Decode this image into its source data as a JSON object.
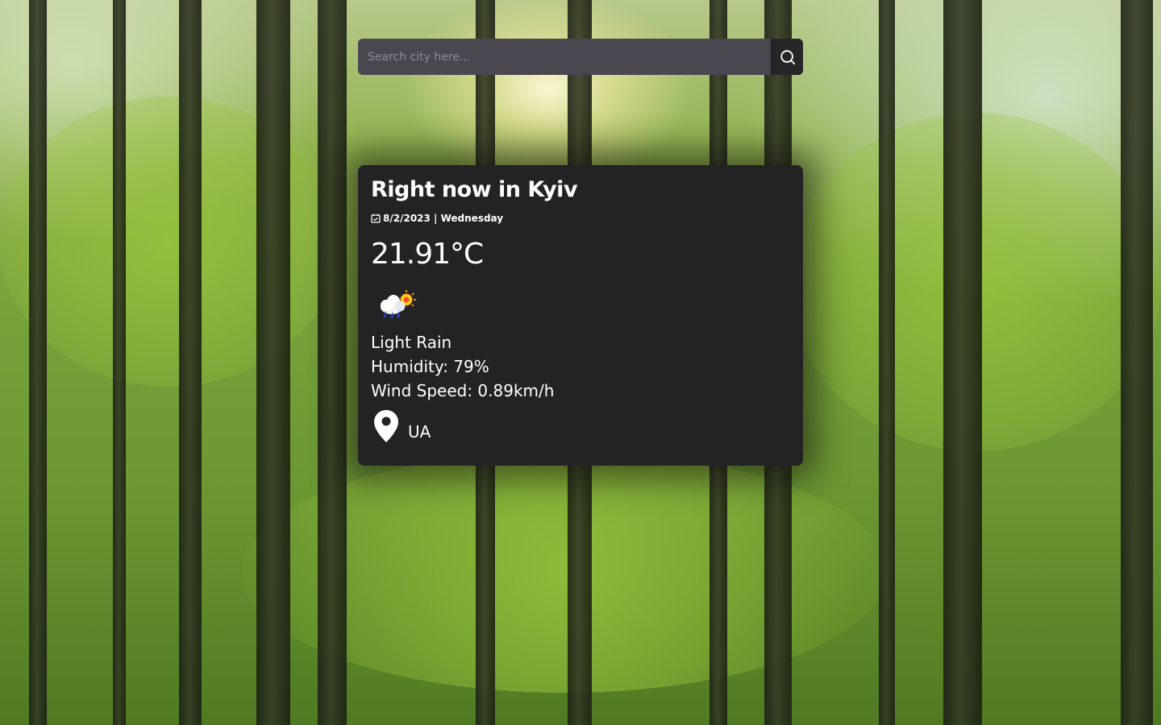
{
  "search": {
    "placeholder": "Search city here...",
    "value": ""
  },
  "weather": {
    "title": "Right now in Kyiv",
    "date": "8/2/2023 | Wednesday",
    "temperature": "21.91°C",
    "condition": "Light Rain",
    "humidity": "Humidity: 79%",
    "wind": "Wind Speed: 0.89km/h",
    "country": "UA"
  },
  "icons": {
    "search": "search-icon",
    "calendar": "calendar-icon",
    "weather": "light-rain-icon",
    "location": "map-pin-icon"
  },
  "colors": {
    "card_bg": "#232224",
    "search_bg": "#4a4750",
    "search_button_bg": "#262527",
    "text": "#ffffff"
  }
}
